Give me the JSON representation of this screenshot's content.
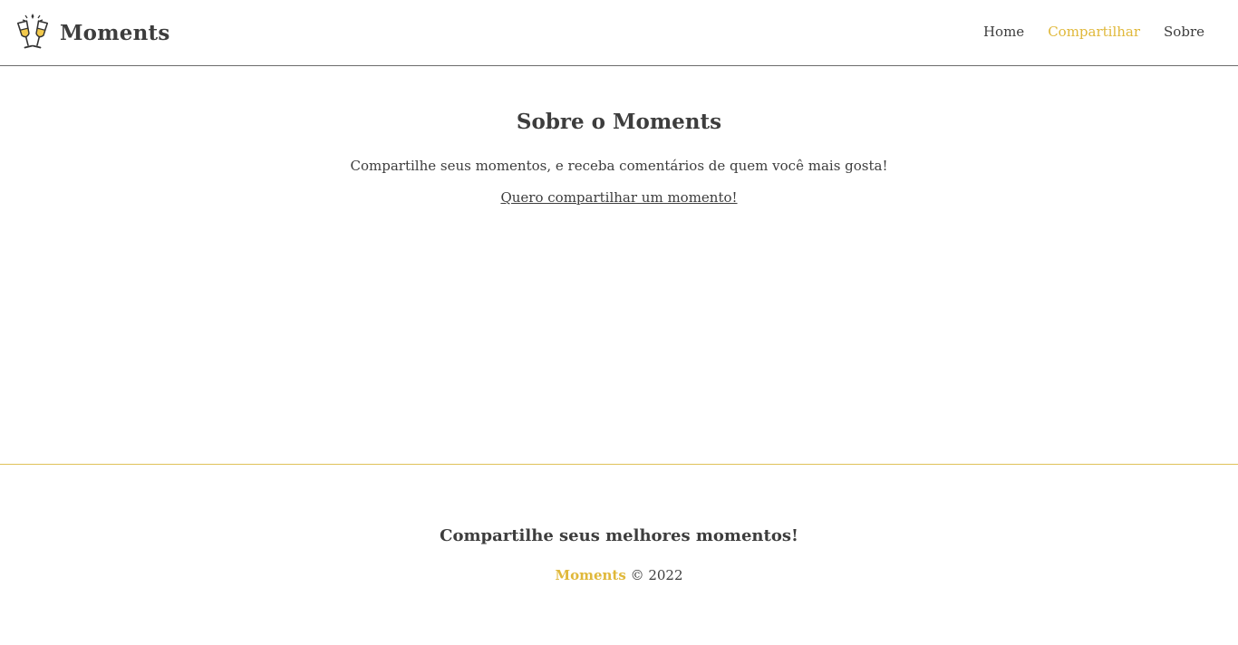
{
  "header": {
    "brand_name": "Moments",
    "logo_icon": "champagne-toast-icon",
    "nav": {
      "home": "Home",
      "share": "Compartilhar",
      "about": "Sobre"
    },
    "active_nav": "share"
  },
  "main": {
    "title": "Sobre o Moments",
    "description": "Compartilhe seus momentos, e receba comentários de quem você mais gosta!",
    "cta_link": "Quero compartilhar um momento!"
  },
  "footer": {
    "tagline": "Compartilhe seus melhores momentos!",
    "brand": "Moments",
    "copyright": "© 2022"
  },
  "colors": {
    "accent": "#e0b83a",
    "text": "#3d3d3d",
    "header_border": "#6b6b6b",
    "footer_border": "#e0c25a"
  }
}
